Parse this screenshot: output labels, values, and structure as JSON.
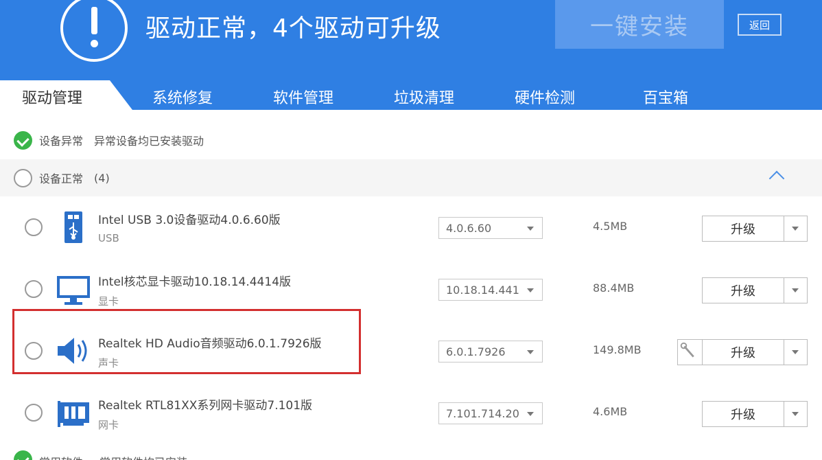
{
  "header": {
    "title": "驱动正常，4个驱动可升级",
    "install_button": "一键安装",
    "back_button": "返回"
  },
  "tabs": [
    {
      "label": "驱动管理",
      "active": true
    },
    {
      "label": "系统修复",
      "active": false
    },
    {
      "label": "软件管理",
      "active": false
    },
    {
      "label": "垃圾清理",
      "active": false
    },
    {
      "label": "硬件检测",
      "active": false
    },
    {
      "label": "百宝箱",
      "active": false
    }
  ],
  "abnormal": {
    "label": "设备异常",
    "description": "异常设备均已安装驱动"
  },
  "normal": {
    "label": "设备正常",
    "count": "(4)"
  },
  "drivers": [
    {
      "name": "Intel USB 3.0设备驱动4.0.6.60版",
      "category": "USB",
      "version": "4.0.6.60",
      "size": "4.5MB",
      "action": "升级",
      "icon": "usb-icon"
    },
    {
      "name": "Intel核芯显卡驱动10.18.14.4414版",
      "category": "显卡",
      "version": "10.18.14.441",
      "size": "88.4MB",
      "action": "升级",
      "icon": "monitor-icon"
    },
    {
      "name": "Realtek HD Audio音频驱动6.0.1.7926版",
      "category": "声卡",
      "version": "6.0.1.7926",
      "size": "149.8MB",
      "action": "升级",
      "icon": "speaker-icon"
    },
    {
      "name": "Realtek RTL81XX系列网卡驱动7.101版",
      "category": "网卡",
      "version": "7.101.714.20",
      "size": "4.6MB",
      "action": "升级",
      "icon": "network-card-icon"
    }
  ],
  "footer": {
    "label": "常用软件",
    "description": "常用软件均已安装"
  },
  "colors": {
    "header_blue": "#2f7fe3",
    "check_green": "#3ab54a",
    "highlight_red": "#d32f2f"
  }
}
